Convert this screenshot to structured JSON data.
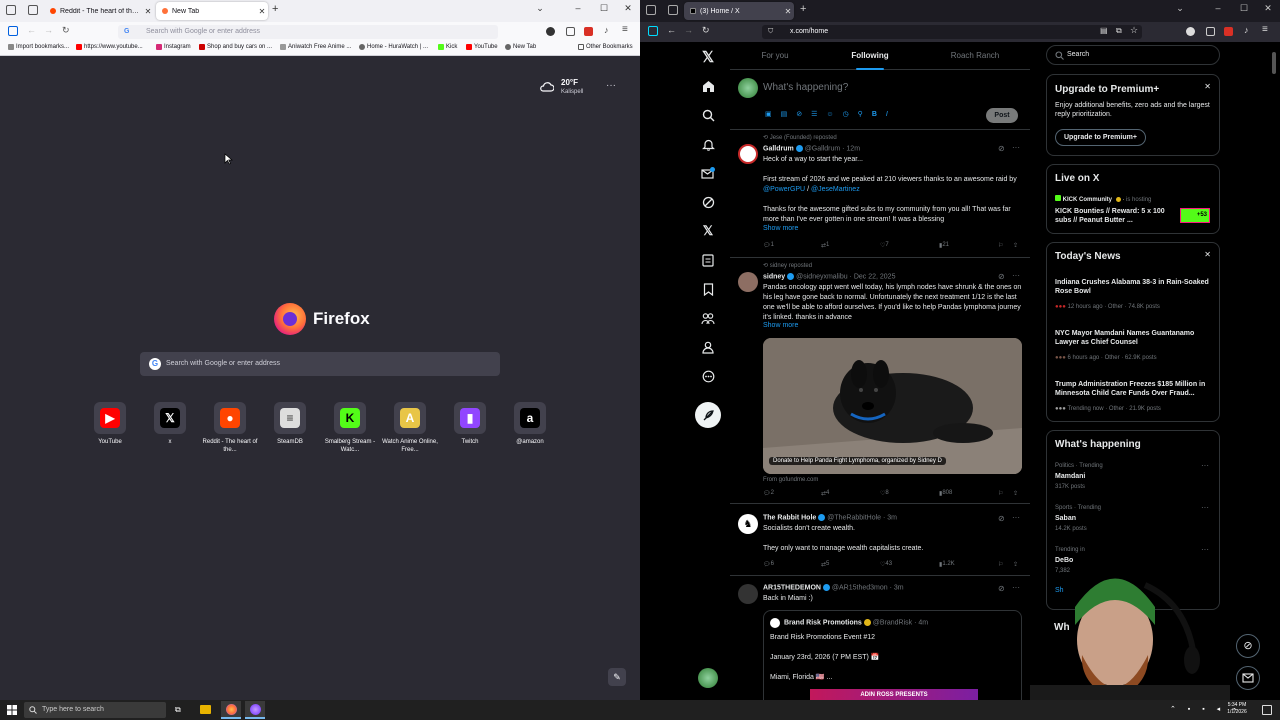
{
  "left": {
    "tabs": [
      {
        "title": "Reddit - The heart of the intern"
      },
      {
        "title": "New Tab"
      }
    ],
    "address_placeholder": "Search with Google or enter address",
    "bookmarks": [
      "Import bookmarks...",
      "https://www.youtube...",
      "Instagram",
      "Shop and buy cars on ...",
      "Aniwatch Free Anime ...",
      "Home - HuraWatch | ...",
      "Kick",
      "YouTube",
      "New Tab"
    ],
    "other_bookmarks": "Other Bookmarks",
    "weather": {
      "temp": "20°F",
      "city": "Kalispell"
    },
    "brand": "Firefox",
    "search_placeholder": "Search with Google or enter address",
    "shortcuts": [
      {
        "label": "YouTube",
        "icon": "youtube-icon",
        "color": "#ff0000"
      },
      {
        "label": "x",
        "icon": "x-logo-icon",
        "color": "#000000"
      },
      {
        "label": "Reddit - The heart of the...",
        "icon": "reddit-icon",
        "color": "#ff4500"
      },
      {
        "label": "SteamDB",
        "icon": "steamdb-icon",
        "color": "#dddddd"
      },
      {
        "label": "Smalberg Stream - Watc...",
        "icon": "kick-icon",
        "color": "#53fc18"
      },
      {
        "label": "Watch Anime Online, Free...",
        "icon": "anime-icon",
        "color": "#e8c547"
      },
      {
        "label": "Twitch",
        "icon": "twitch-icon",
        "color": "#9146ff"
      },
      {
        "label": "@amazon",
        "icon": "amazon-icon",
        "color": "#000000"
      }
    ]
  },
  "right": {
    "tab_title": "(3) Home / X",
    "url": "x.com/home",
    "feed_tabs": [
      "For you",
      "Following",
      "Roach Ranch"
    ],
    "compose_placeholder": "What's happening?",
    "post_label": "Post",
    "tweets": [
      {
        "repost": "Jese (Founded) reposted",
        "name": "Galldrum",
        "handle": "@Galldrum · 12m",
        "lines": [
          "Heck of a way to start the year...",
          "",
          "First stream of 2026 and we peaked at 210 viewers thanks to an awesome raid by @PowerGPU / @JeseMartinez",
          "",
          "Thanks for the awesome gifted subs to my community from you all! That was far more than I've ever gotten in one stream! It was a blessing"
        ],
        "show_more": "Show more",
        "replies": "1",
        "reposts": "1",
        "likes": "7",
        "views": "21"
      },
      {
        "repost": "sidney reposted",
        "name": "sidney",
        "handle": "@sidneyxmalibu · Dec 22, 2025",
        "lines": [
          "Pandas oncology appt went well today, his lymph nodes have shrunk & the ones on his leg have gone back to normal. Unfortunately the next treatment 1/12 is the last one we'll be able to afford ourselves. If you'd like to help Pandas lymphoma journey it's linked. thanks in advance"
        ],
        "show_more": "Show more",
        "card_caption": "Donate to Help Panda Fight Lymphoma, organized by Sidney D",
        "card_source": "From gofundme.com",
        "replies": "2",
        "reposts": "4",
        "likes": "8",
        "views": "808"
      },
      {
        "name": "The Rabbit Hole",
        "handle": "@TheRabbitHole · 3m",
        "lines": [
          "Socialists don't create wealth.",
          "",
          "They only want to manage wealth capitalists create."
        ],
        "replies": "6",
        "reposts": "5",
        "likes": "43",
        "views": "1.2K"
      },
      {
        "name": "AR15THEDEMON",
        "handle": "@AR15thed3mon · 3m",
        "lines": [
          "Back in Miami :)"
        ],
        "quote": {
          "name": "Brand Risk Promotions",
          "handle": "@BrandRisk · 4m",
          "lines": [
            "Brand Risk Promotions Event #12",
            "",
            "January 23rd, 2026 (7 PM EST) 📅",
            "",
            "Miami, Florida 🇺🇸 ..."
          ],
          "banner": "ADIN ROSS PRESENTS"
        }
      }
    ],
    "search_placeholder": "Search",
    "premium": {
      "title": "Upgrade to Premium+",
      "text": "Enjoy additional benefits, zero ads and the largest reply prioritization.",
      "button": "Upgrade to Premium+"
    },
    "live": {
      "title": "Live on X",
      "host": "KICK Community",
      "hosting": "is hosting",
      "text": "KICK Bounties // Reward: 5 x 100 subs // Peanut Butter ...",
      "badge": "+53"
    },
    "news": {
      "title": "Today's News",
      "items": [
        {
          "headline": "Indiana Crushes Alabama 38-3 in Rain-Soaked Rose Bowl",
          "meta": "12 hours ago · Other · 74.8K posts"
        },
        {
          "headline": "NYC Mayor Mamdani Names Guantanamo Lawyer as Chief Counsel",
          "meta": "6 hours ago · Other · 62.9K posts"
        },
        {
          "headline": "Trump Administration Freezes $185 Million in Minnesota Child Care Funds Over Fraud...",
          "meta": "Trending now · Other · 21.9K posts"
        }
      ]
    },
    "happening": {
      "title": "What's happening",
      "items": [
        {
          "category": "Politics · Trending",
          "topic": "Mamdani",
          "count": "317K posts"
        },
        {
          "category": "Sports · Trending",
          "topic": "Saban",
          "count": "14.2K posts"
        },
        {
          "category": "Trending in",
          "topic": "DeBo",
          "count": "7,382"
        }
      ],
      "show": "Sh",
      "next_title": "Wh"
    }
  },
  "taskbar": {
    "search_placeholder": "Type here to search",
    "time": "5:34 PM",
    "date": "1/1/2026"
  }
}
